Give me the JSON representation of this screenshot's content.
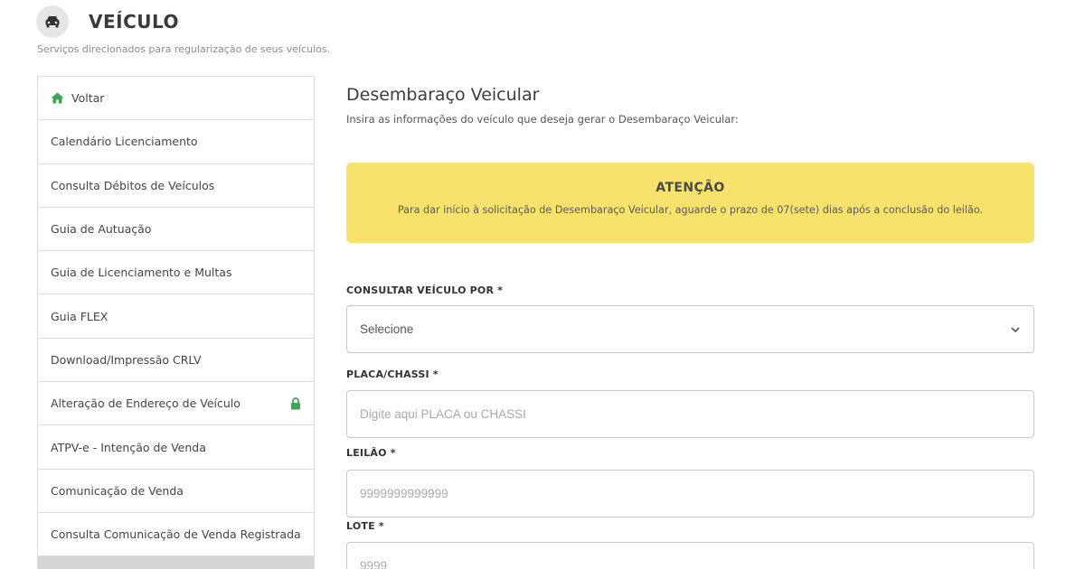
{
  "header": {
    "title": "VEÍCULO",
    "subtitle": "Serviços direcionados para regularização de seus veículos."
  },
  "sidebar": {
    "items": [
      {
        "label": "Voltar",
        "icon": "home-icon"
      },
      {
        "label": "Calendário Licenciamento"
      },
      {
        "label": "Consulta Débitos de Veículos"
      },
      {
        "label": "Guia de Autuação"
      },
      {
        "label": "Guia de Licenciamento e Multas"
      },
      {
        "label": "Guia FLEX"
      },
      {
        "label": "Download/Impressão CRLV"
      },
      {
        "label": "Alteração de Endereço de Veículo",
        "icon": "lock-icon"
      },
      {
        "label": "ATPV-e - Intenção de Venda"
      },
      {
        "label": "Comunicação de Venda"
      },
      {
        "label": "Consulta Comunicação de Venda Registrada"
      }
    ]
  },
  "main": {
    "title": "Desembaraço Veicular",
    "subtitle": "Insira as informações do veículo que deseja gerar o Desembaraço Veicular:"
  },
  "alert": {
    "title": "ATENÇÃO",
    "text": "Para dar início à solicitação de Desembaraço Veicular, aguarde o prazo de 07(sete) dias após a conclusão do leilão."
  },
  "form": {
    "consultar": {
      "label": "CONSULTAR VEÍCULO POR *",
      "value": "Selecione"
    },
    "placa": {
      "label": "PLACA/CHASSI *",
      "placeholder": "Digite aqui PLACA ou CHASSI"
    },
    "leilao": {
      "label": "LEILÃO *",
      "placeholder": "9999999999999"
    },
    "lote": {
      "label": "LOTE *",
      "placeholder": "9999"
    }
  },
  "colors": {
    "alert_bg": "#f6e26d",
    "icon_green": "#3aa655"
  }
}
